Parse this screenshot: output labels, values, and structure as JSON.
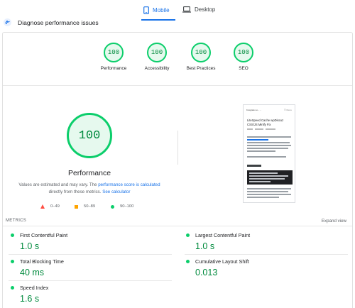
{
  "tabs": [
    {
      "label": "Mobile",
      "icon": "smartphone-icon",
      "selected": true
    },
    {
      "label": "Desktop",
      "icon": "laptop-icon",
      "selected": false
    }
  ],
  "diagnose": {
    "label": "Diagnose performance issues",
    "icon": "diagnose-icon"
  },
  "summary_gauges": [
    {
      "score": "100",
      "label": "Performance"
    },
    {
      "score": "100",
      "label": "Accessibility"
    },
    {
      "score": "100",
      "label": "Best Practices"
    },
    {
      "score": "100",
      "label": "SEO"
    }
  ],
  "performance": {
    "score": "100",
    "title": "Performance",
    "note_prefix": "Values are estimated and may vary. The ",
    "note_link": "performance score is calculated",
    "note_middle": " directly from these metrics. ",
    "note_calc_link": "See calculator"
  },
  "legend": [
    {
      "range": "0–49",
      "shape": "triangle",
      "color": "#ff4e42"
    },
    {
      "range": "50–89",
      "shape": "square",
      "color": "#ffa400"
    },
    {
      "range": "90–100",
      "shape": "circle",
      "color": "#0cce6b"
    }
  ],
  "thumbnail": {
    "site": "Kreigtalo.no - ...",
    "menu": "☰ Menu",
    "title": "LiteSpeed Cache wpDiscuz CSS/JS Minify Fix"
  },
  "metrics_section": {
    "label": "METRICS",
    "expand": "Expand view"
  },
  "metrics": [
    {
      "name": "First Contentful Paint",
      "value": "1.0 s"
    },
    {
      "name": "Largest Contentful Paint",
      "value": "1.0 s"
    },
    {
      "name": "Total Blocking Time",
      "value": "40 ms"
    },
    {
      "name": "Cumulative Layout Shift",
      "value": "0.013"
    },
    {
      "name": "Speed Index",
      "value": "1.6 s"
    }
  ],
  "colors": {
    "accent": "#1a73e8",
    "pass": "#0cce6b",
    "pass_text": "#008a3d",
    "average": "#ffa400",
    "fail": "#ff4e42"
  }
}
